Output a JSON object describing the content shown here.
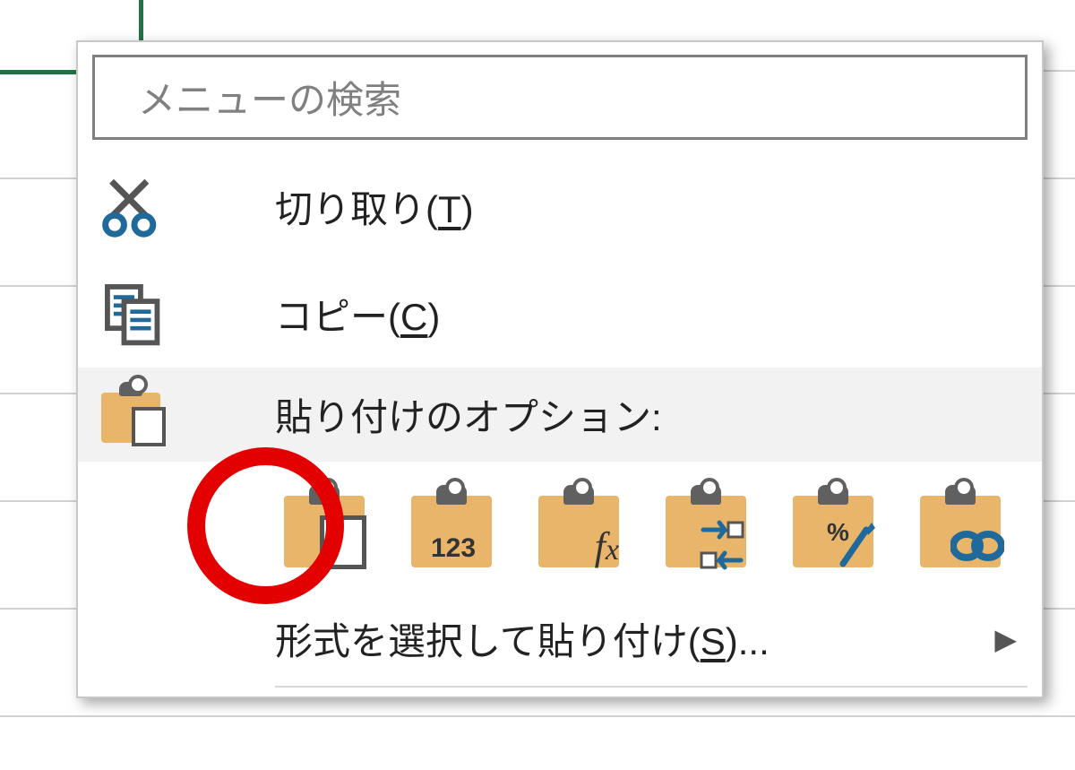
{
  "search": {
    "placeholder": "メニューの検索"
  },
  "menu": {
    "cut": {
      "label_pre": "切り取り(",
      "hotkey": "T",
      "label_post": ")"
    },
    "copy": {
      "label_pre": "コピー(",
      "hotkey": "C",
      "label_post": ")"
    },
    "paste_options_header": "貼り付けのオプション:",
    "paste_options": {
      "paste": {
        "name": "paste"
      },
      "paste_values": {
        "name": "paste-values",
        "overlay_text": "123"
      },
      "paste_formulas": {
        "name": "paste-formulas",
        "fx_f": "f",
        "fx_x": "x"
      },
      "paste_transpose": {
        "name": "paste-transpose"
      },
      "paste_formatting": {
        "name": "paste-formatting",
        "pct": "%"
      },
      "paste_link": {
        "name": "paste-link"
      }
    },
    "paste_special": {
      "label_pre": "形式を選択して貼り付け(",
      "hotkey": "S",
      "label_post": ")..."
    }
  }
}
